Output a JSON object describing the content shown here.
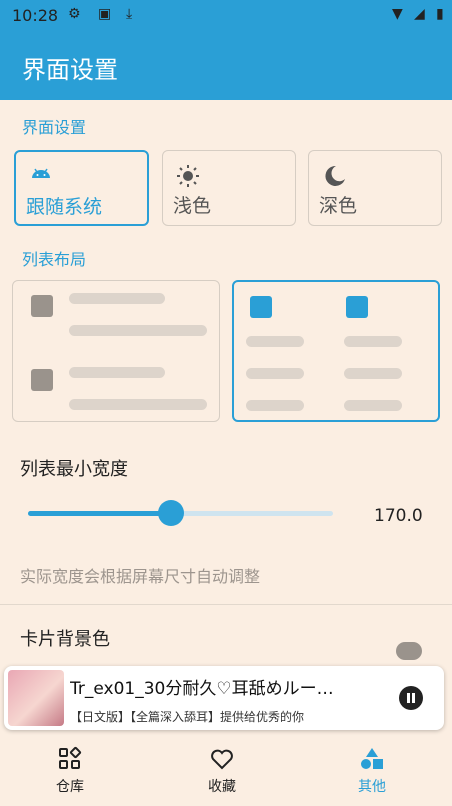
{
  "status_bar": {
    "time": "10:28"
  },
  "app_bar": {
    "title": "界面设置"
  },
  "sections": {
    "theme_title": "界面设置",
    "layout_title": "列表布局"
  },
  "theme_options": [
    {
      "label": "跟随系统",
      "icon": "android-icon",
      "selected": true
    },
    {
      "label": "浅色",
      "icon": "sun-icon",
      "selected": false
    },
    {
      "label": "深色",
      "icon": "moon-icon",
      "selected": false
    }
  ],
  "layout_options": [
    {
      "name": "list",
      "selected": false
    },
    {
      "name": "grid",
      "selected": true
    }
  ],
  "min_width": {
    "label": "列表最小宽度",
    "value_text": "170.0",
    "slider_fraction": 0.47,
    "hint": "实际宽度会根据屏幕尺寸自动调整"
  },
  "card_background": {
    "label": "卡片背景色",
    "enabled": false
  },
  "player": {
    "title": "Tr_ex01_30分耐久♡耳舐めルー…",
    "subtitle": "【日文版】【全篇深入舔耳】提供给优秀的你"
  },
  "bottom_nav": [
    {
      "label": "仓库",
      "icon": "library-icon",
      "active": false
    },
    {
      "label": "收藏",
      "icon": "heart-icon",
      "active": false
    },
    {
      "label": "其他",
      "icon": "shapes-icon",
      "active": true
    }
  ],
  "colors": {
    "accent": "#2a9fd6",
    "background": "#fbeee2"
  }
}
